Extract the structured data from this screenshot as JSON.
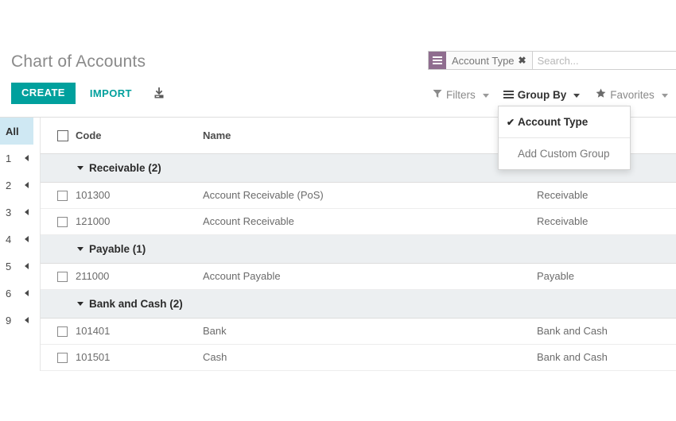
{
  "header": {
    "title": "Chart of Accounts",
    "create_label": "CREATE",
    "import_label": "IMPORT",
    "export_icon": "download-icon"
  },
  "search": {
    "placeholder": "Search...",
    "value": "",
    "facet": {
      "icon": "group-by-icon",
      "label": "Account Type",
      "remove_label": "✖"
    }
  },
  "search_buttons": [
    {
      "id": "filters",
      "label": "Filters",
      "icon": "filter-icon",
      "active": false
    },
    {
      "id": "group_by",
      "label": "Group By",
      "icon": "list-icon",
      "active": true
    },
    {
      "id": "favorites",
      "label": "Favorites",
      "icon": "star-icon",
      "active": false
    }
  ],
  "group_by_menu": {
    "open": true,
    "items": [
      {
        "label": "Account Type",
        "checked": true,
        "check_glyph": "✔"
      },
      {
        "label": "Add Custom Group",
        "checked": false
      }
    ]
  },
  "sidebar": {
    "items": [
      {
        "label": "All",
        "selected": true,
        "has_arrow": false
      },
      {
        "label": "1",
        "selected": false,
        "has_arrow": true
      },
      {
        "label": "2",
        "selected": false,
        "has_arrow": true
      },
      {
        "label": "3",
        "selected": false,
        "has_arrow": true
      },
      {
        "label": "4",
        "selected": false,
        "has_arrow": true
      },
      {
        "label": "5",
        "selected": false,
        "has_arrow": true
      },
      {
        "label": "6",
        "selected": false,
        "has_arrow": true
      },
      {
        "label": "9",
        "selected": false,
        "has_arrow": true
      }
    ]
  },
  "list": {
    "columns": [
      {
        "key": "code",
        "label": "Code"
      },
      {
        "key": "name",
        "label": "Name"
      },
      {
        "key": "type",
        "label": ""
      }
    ],
    "groups": [
      {
        "label": "Receivable (2)",
        "caret": "▾",
        "rows": [
          {
            "code": "101300",
            "name": "Account Receivable (PoS)",
            "type": "Receivable"
          },
          {
            "code": "121000",
            "name": "Account Receivable",
            "type": "Receivable"
          }
        ]
      },
      {
        "label": "Payable (1)",
        "caret": "▾",
        "rows": [
          {
            "code": "211000",
            "name": "Account Payable",
            "type": "Payable"
          }
        ]
      },
      {
        "label": "Bank and Cash (2)",
        "caret": "▾",
        "rows": [
          {
            "code": "101401",
            "name": "Bank",
            "type": "Bank and Cash"
          },
          {
            "code": "101501",
            "name": "Cash",
            "type": "Bank and Cash"
          }
        ]
      }
    ]
  },
  "colors": {
    "accent": "#00a09d",
    "facet_icon": "#8f6d8f",
    "sidebar_selected": "#cfe8f3",
    "group_row": "#eceff1"
  }
}
